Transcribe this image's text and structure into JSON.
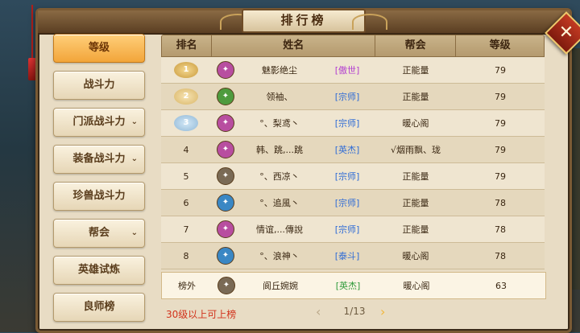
{
  "title": "排行榜",
  "close_icon": "close-x-icon",
  "sidebar": {
    "items": [
      {
        "label": "等级",
        "active": true,
        "chevron": false
      },
      {
        "label": "战斗力",
        "active": false,
        "chevron": false
      },
      {
        "label": "门派战斗力",
        "active": false,
        "chevron": true
      },
      {
        "label": "装备战斗力",
        "active": false,
        "chevron": true
      },
      {
        "label": "珍兽战斗力",
        "active": false,
        "chevron": false
      },
      {
        "label": "帮会",
        "active": false,
        "chevron": true
      },
      {
        "label": "英雄试炼",
        "active": false,
        "chevron": false
      },
      {
        "label": "良师榜",
        "active": false,
        "chevron": false
      }
    ],
    "chevron_glyph": "⌄"
  },
  "table": {
    "headers": {
      "rank": "排名",
      "name": "姓名",
      "guild": "帮会",
      "level": "等级"
    },
    "rows": [
      {
        "rank": "1",
        "medal": "gold",
        "avatar_color": "#b84ea0",
        "name": "魅影绝尘",
        "tag": "[傲世]",
        "tag_color": "#b23ed1",
        "guild": "正能量",
        "level": "79"
      },
      {
        "rank": "2",
        "medal": "silver",
        "avatar_color": "#4e9b3e",
        "name": "领袖、",
        "tag": "[宗师]",
        "tag_color": "#2e6bd6",
        "guild": "正能量",
        "level": "79"
      },
      {
        "rank": "3",
        "medal": "blue",
        "avatar_color": "#b84ea0",
        "name": "°、梨鸢丶",
        "tag": "[宗师]",
        "tag_color": "#2e6bd6",
        "guild": "暖心阁",
        "level": "79"
      },
      {
        "rank": "4",
        "medal": "",
        "avatar_color": "#b84ea0",
        "name": "韩、跳,...跳",
        "tag": "[英杰]",
        "tag_color": "#2e6bd6",
        "guild": "√烟雨飘、珑",
        "level": "79"
      },
      {
        "rank": "5",
        "medal": "",
        "avatar_color": "#7a6a55",
        "name": "°、西凉丶",
        "tag": "[宗师]",
        "tag_color": "#2e6bd6",
        "guild": "正能量",
        "level": "79"
      },
      {
        "rank": "6",
        "medal": "",
        "avatar_color": "#3a87c4",
        "name": "°、追風丶",
        "tag": "[宗师]",
        "tag_color": "#2e6bd6",
        "guild": "正能量",
        "level": "78"
      },
      {
        "rank": "7",
        "medal": "",
        "avatar_color": "#b84ea0",
        "name": "情谊,...傳說",
        "tag": "[宗师]",
        "tag_color": "#2e6bd6",
        "guild": "正能量",
        "level": "78"
      },
      {
        "rank": "8",
        "medal": "",
        "avatar_color": "#3a87c4",
        "name": "°、浪神丶",
        "tag": "[泰斗]",
        "tag_color": "#2e6bd6",
        "guild": "暖心阁",
        "level": "78"
      }
    ],
    "my_row": {
      "rank": "榜外",
      "avatar_color": "#7a6a55",
      "name": "阆丘婉婉",
      "tag": "[英杰]",
      "tag_color": "#2f9a3a",
      "guild": "暖心阁",
      "level": "63"
    }
  },
  "footer": {
    "note": "30级以上可上榜",
    "page": "1/13",
    "prev_glyph": "‹",
    "next_glyph": "›"
  }
}
